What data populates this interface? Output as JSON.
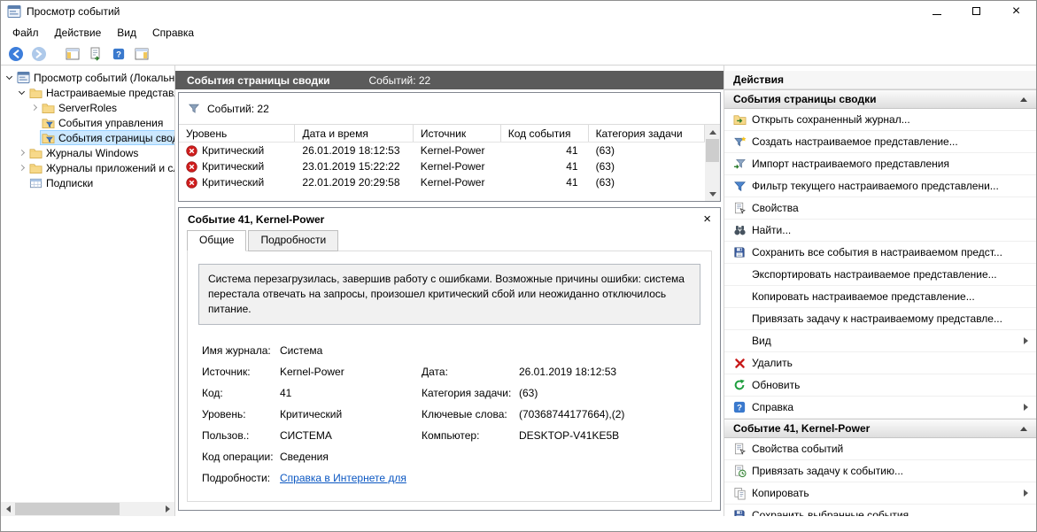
{
  "window": {
    "title": "Просмотр событий",
    "menu": [
      {
        "key": "file",
        "label": "Файл"
      },
      {
        "key": "action",
        "label": "Действие"
      },
      {
        "key": "view",
        "label": "Вид"
      },
      {
        "key": "help",
        "label": "Справка"
      }
    ],
    "toolbar": [
      {
        "key": "back",
        "icon": "back-arrow"
      },
      {
        "key": "forward",
        "icon": "forward-arrow"
      },
      {
        "key": "console-tree-toggle",
        "icon": "console-tree"
      },
      {
        "key": "export-list",
        "icon": "export-list"
      },
      {
        "key": "help",
        "icon": "help"
      },
      {
        "key": "action-pane-toggle",
        "icon": "action-pane"
      }
    ],
    "controls": [
      {
        "key": "minimize"
      },
      {
        "key": "maximize"
      },
      {
        "key": "close"
      }
    ]
  },
  "tree": {
    "items": [
      {
        "label": "Просмотр событий (Локальн",
        "level": 0,
        "expander": "open",
        "icon": "app",
        "selected": false
      },
      {
        "label": "Настраиваемые представле",
        "level": 1,
        "expander": "open",
        "icon": "folder",
        "selected": false
      },
      {
        "label": "ServerRoles",
        "level": 2,
        "expander": "closed",
        "icon": "folder",
        "selected": false
      },
      {
        "label": "События управления",
        "level": 2,
        "expander": null,
        "icon": "custom-view",
        "selected": false
      },
      {
        "label": "События страницы свод",
        "level": 2,
        "expander": null,
        "icon": "custom-view",
        "selected": true
      },
      {
        "label": "Журналы Windows",
        "level": 1,
        "expander": "closed",
        "icon": "folder",
        "selected": false
      },
      {
        "label": "Журналы приложений и сл",
        "level": 1,
        "expander": "closed",
        "icon": "folder",
        "selected": false
      },
      {
        "label": "Подписки",
        "level": 1,
        "expander": null,
        "icon": "subscriptions",
        "selected": false
      }
    ]
  },
  "center": {
    "header": {
      "title": "События страницы сводки",
      "count": "Событий: 22"
    },
    "summary": {
      "icon": "funnel-gray",
      "count": "Событий: 22"
    },
    "table": {
      "columns": [
        "Уровень",
        "Дата и время",
        "Источник",
        "Код события",
        "Категория задачи"
      ],
      "rows": [
        {
          "icon": "critical",
          "level": "Критический",
          "datetime": "26.01.2019 18:12:53",
          "source": "Kernel-Power",
          "code": "41",
          "category": "(63)"
        },
        {
          "icon": "critical",
          "level": "Критический",
          "datetime": "23.01.2019 15:22:22",
          "source": "Kernel-Power",
          "code": "41",
          "category": "(63)"
        },
        {
          "icon": "critical",
          "level": "Критический",
          "datetime": "22.01.2019 20:29:58",
          "source": "Kernel-Power",
          "code": "41",
          "category": "(63)"
        }
      ]
    },
    "detail": {
      "title": "Событие 41, Kernel-Power",
      "tabs": [
        {
          "label": "Общие",
          "active": true
        },
        {
          "label": "Подробности",
          "active": false
        }
      ],
      "description": "Система перезагрузилась, завершив работу с ошибками. Возможные причины ошибки: система перестала отвечать на запросы, произошел критический сбой или неожиданно отключилось питание.",
      "fields": [
        {
          "label": "Имя журнала:",
          "value": "Система",
          "label2": "",
          "value2": "",
          "link": false
        },
        {
          "label": "Источник:",
          "value": "Kernel-Power",
          "label2": "Дата:",
          "value2": "26.01.2019 18:12:53",
          "link": false
        },
        {
          "label": "Код:",
          "value": "41",
          "label2": "Категория задачи:",
          "value2": "(63)",
          "link": false
        },
        {
          "label": "Уровень:",
          "value": "Критический",
          "label2": "Ключевые слова:",
          "value2": "(70368744177664),(2)",
          "link": false
        },
        {
          "label": "Пользов.:",
          "value": "СИСТЕМА",
          "label2": "Компьютер:",
          "value2": "DESKTOP-V41KE5B",
          "link": false
        },
        {
          "label": "Код операции:",
          "value": "Сведения",
          "label2": "",
          "value2": "",
          "link": false
        },
        {
          "label": "Подробности:",
          "value": "Справка в Интернете для",
          "label2": "",
          "value2": "",
          "link": true
        }
      ]
    }
  },
  "actions": {
    "title": "Действия",
    "sections": [
      {
        "header": "События страницы сводки",
        "items": [
          {
            "label": "Открыть сохраненный журнал...",
            "icon": "open-log",
            "submenu": false
          },
          {
            "label": "Создать настраиваемое представление...",
            "icon": "create-view",
            "submenu": false
          },
          {
            "label": "Импорт настраиваемого представления",
            "icon": "import-view",
            "submenu": false
          },
          {
            "label": "Фильтр текущего настраиваемого представлени...",
            "icon": "filter",
            "submenu": false
          },
          {
            "label": "Свойства",
            "icon": "properties",
            "submenu": false
          },
          {
            "label": "Найти...",
            "icon": "find",
            "submenu": false
          },
          {
            "label": "Сохранить все события в настраиваемом предст...",
            "icon": "save",
            "submenu": false
          },
          {
            "label": "Экспортировать настраиваемое представление...",
            "icon": "",
            "submenu": false
          },
          {
            "label": "Копировать настраиваемое представление...",
            "icon": "",
            "submenu": false
          },
          {
            "label": "Привязать задачу к настраиваемому представле...",
            "icon": "",
            "submenu": false
          },
          {
            "label": "Вид",
            "icon": "",
            "submenu": true
          },
          {
            "label": "Удалить",
            "icon": "delete",
            "submenu": false
          },
          {
            "label": "Обновить",
            "icon": "refresh",
            "submenu": false
          },
          {
            "label": "Справка",
            "icon": "help",
            "submenu": true
          }
        ]
      },
      {
        "header": "Событие 41, Kernel-Power",
        "items": [
          {
            "label": "Свойства событий",
            "icon": "properties",
            "submenu": false
          },
          {
            "label": "Привязать задачу к событию...",
            "icon": "task",
            "submenu": false
          },
          {
            "label": "Копировать",
            "icon": "copy",
            "submenu": true
          },
          {
            "label": "Сохранить выбранные события",
            "icon": "save",
            "submenu": false
          }
        ]
      }
    ]
  },
  "colors": {
    "critical_red": "#cf1d1d",
    "center_header_bg": "#5b5b5b",
    "selection_blue": "#cce8ff",
    "link_blue": "#0b57c2"
  }
}
